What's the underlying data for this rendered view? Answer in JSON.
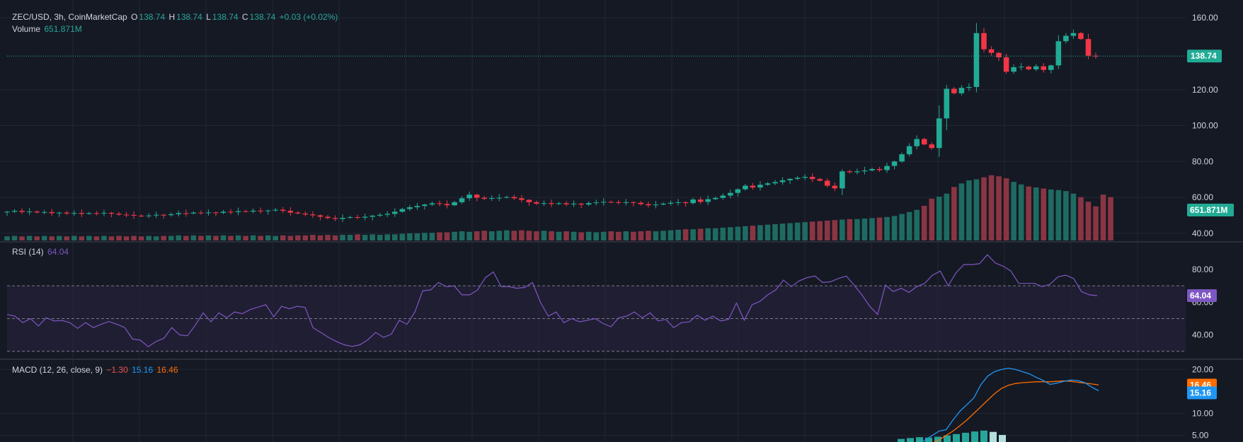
{
  "colors": {
    "background": "#151924",
    "grid": "#232734",
    "text": "#d1d4dc",
    "up": "#22ab94",
    "down": "#f23645",
    "volume_up": "#1e6b61",
    "volume_down": "#8a3543",
    "rsi": "#7e57c2",
    "rsi_band": "#2a2340",
    "macd": "#2196f3",
    "signal": "#ff6d00",
    "hist_up": "#26a69a",
    "hist_up_light": "#b2dfdb"
  },
  "legend": {
    "symbol": "ZEC/USD, 3h, CoinMarketCap",
    "o_label": "O",
    "o_value": "138.74",
    "h_label": "H",
    "h_value": "138.74",
    "l_label": "L",
    "l_value": "138.74",
    "c_label": "C",
    "c_value": "138.74",
    "change": "+0.03 (+0.02%)",
    "volume_label": "Volume",
    "volume_value": "651.871M",
    "rsi_label": "RSI (14)",
    "rsi_value": "64.04",
    "macd_label": "MACD (12, 26, close, 9)",
    "macd_hist_value": "−1.30",
    "macd_value": "15.16",
    "signal_value": "16.46"
  },
  "chart_data": [
    {
      "type": "candlestick",
      "pane": "price",
      "ylim": [
        36,
        166
      ],
      "y_ticks": [
        "160.00",
        "120.00",
        "100.00",
        "80.00",
        "60.00",
        "40.00"
      ],
      "y_tick_values": [
        160,
        120,
        100,
        80,
        60,
        40
      ],
      "last_price": 138.74,
      "last_price_label": "138.74",
      "volume_label": "651.871M",
      "closes": [
        52.0,
        52.5,
        51.9,
        52.1,
        51.6,
        51.8,
        51.2,
        51.5,
        51.0,
        51.3,
        50.8,
        51.2,
        51.0,
        51.4,
        50.9,
        50.4,
        50.2,
        49.8,
        49.5,
        49.9,
        50.3,
        50.1,
        50.6,
        51.2,
        51.0,
        51.5,
        51.3,
        51.6,
        51.4,
        52.0,
        51.8,
        52.3,
        52.1,
        52.6,
        52.4,
        52.7,
        53.1,
        52.5,
        51.5,
        51.0,
        50.5,
        50.0,
        49.2,
        48.5,
        48.0,
        48.6,
        49.0,
        48.7,
        49.2,
        49.8,
        50.3,
        50.8,
        52.0,
        53.5,
        54.5,
        55.2,
        56.0,
        56.7,
        56.3,
        55.6,
        57.3,
        59.5,
        61.5,
        59.8,
        59.2,
        59.6,
        59.8,
        60.2,
        59.5,
        58.6,
        57.3,
        56.5,
        56.8,
        56.3,
        56.7,
        56.1,
        56.5,
        56.0,
        56.8,
        57.2,
        57.5,
        57.3,
        57.0,
        57.3,
        57.0,
        56.2,
        55.6,
        56.0,
        56.5,
        57.0,
        57.3,
        56.8,
        58.8,
        57.5,
        59.0,
        59.7,
        61.0,
        62.5,
        64.5,
        66.5,
        65.5,
        67.0,
        67.8,
        68.5,
        69.5,
        70.3,
        70.9,
        71.4,
        70.2,
        69.3,
        66.5,
        65.0,
        74.5,
        74.0,
        74.5,
        75.0,
        75.8,
        75.2,
        77.5,
        80.0,
        84.0,
        88.5,
        92.5,
        89.5,
        87.5,
        104.0,
        120.5,
        118.0,
        121.0,
        121.5,
        151.5,
        142.5,
        140.5,
        138.0,
        130.0,
        132.5,
        132.8,
        131.3,
        133.0,
        131.0,
        133.5,
        147.0,
        150.0,
        151.5,
        148.2,
        138.9,
        138.74
      ],
      "volumes": [
        8,
        9,
        8,
        9,
        8,
        9,
        8,
        9,
        8,
        9,
        8,
        9,
        8,
        9,
        8,
        9,
        8,
        9,
        8,
        9,
        8,
        9,
        9,
        10,
        9,
        10,
        9,
        10,
        9,
        10,
        9,
        10,
        9,
        10,
        9,
        10,
        9,
        10,
        9,
        10,
        10,
        11,
        10,
        11,
        10,
        11,
        11,
        12,
        11,
        12,
        11,
        12,
        12,
        13,
        14,
        14,
        15,
        15,
        16,
        16,
        17,
        18,
        17,
        18,
        19,
        18,
        19,
        20,
        19,
        20,
        19,
        18,
        19,
        18,
        17,
        18,
        17,
        16,
        17,
        16,
        17,
        18,
        17,
        18,
        17,
        18,
        19,
        18,
        19,
        20,
        21,
        22,
        22,
        23,
        24,
        24,
        25,
        26,
        27,
        28,
        29,
        30,
        31,
        32,
        33,
        34,
        35,
        36,
        37,
        38,
        39,
        40,
        41,
        42,
        42,
        43,
        44,
        45,
        46,
        48,
        52,
        56,
        60,
        68,
        82,
        86,
        92,
        105,
        112,
        118,
        120,
        124,
        128,
        126,
        122,
        115,
        110,
        106,
        104,
        102,
        100,
        99,
        97,
        92,
        85,
        76,
        67,
        90,
        85
      ]
    },
    {
      "type": "line",
      "pane": "rsi",
      "ylim": [
        26,
        96
      ],
      "y_ticks": [
        "80.00",
        "60.00",
        "40.00"
      ],
      "y_tick_values": [
        80,
        60,
        40
      ],
      "levels": [
        70,
        50,
        30
      ],
      "band": [
        30,
        70
      ],
      "last_label": "64.04",
      "values": [
        52.5,
        51.5,
        47.5,
        50.0,
        45.5,
        50.5,
        48.5,
        48.8,
        47.5,
        44.0,
        47.5,
        44.5,
        46.5,
        48.2,
        46.5,
        44.5,
        37.5,
        36.8,
        32.8,
        36.0,
        38.0,
        44.5,
        40.0,
        39.5,
        46.0,
        53.5,
        48.0,
        53.5,
        50.5,
        54.0,
        53.0,
        55.5,
        57.0,
        58.5,
        51.0,
        57.5,
        56.0,
        57.5,
        56.8,
        44.5,
        41.5,
        38.5,
        36.0,
        34.0,
        33.0,
        34.0,
        37.0,
        41.5,
        38.5,
        40.5,
        49.0,
        46.5,
        54.0,
        67.0,
        67.5,
        72.0,
        69.5,
        70.0,
        64.5,
        64.5,
        67.5,
        75.0,
        78.5,
        69.5,
        69.5,
        68.5,
        69.0,
        72.0,
        60.0,
        51.5,
        54.0,
        47.5,
        50.0,
        48.0,
        49.0,
        50.0,
        47.0,
        45.0,
        50.5,
        51.5,
        54.0,
        50.5,
        53.5,
        48.5,
        49.5,
        44.5,
        47.5,
        48.0,
        52.0,
        49.0,
        51.5,
        48.5,
        49.5,
        59.5,
        49.0,
        58.5,
        60.5,
        64.5,
        67.5,
        73.5,
        69.5,
        73.0,
        75.0,
        76.0,
        72.0,
        72.5,
        74.5,
        76.0,
        70.5,
        64.5,
        57.5,
        52.5,
        70.5,
        66.5,
        68.5,
        66.0,
        69.5,
        71.5,
        76.5,
        79.0,
        70.0,
        78.0,
        83.0,
        83.0,
        83.5,
        89.0,
        84.0,
        82.0,
        79.0,
        71.5,
        71.5,
        71.5,
        69.5,
        71.0,
        75.5,
        76.5,
        74.5,
        66.5,
        64.5,
        64.04
      ]
    },
    {
      "type": "line",
      "pane": "macd",
      "ylim": [
        3.5,
        22.0
      ],
      "y_ticks": [
        "20.00",
        "10.00",
        "5.00"
      ],
      "y_tick_values": [
        20,
        10,
        5
      ],
      "macd_label": "15.16",
      "signal_label": "16.46",
      "macd_values": [
        1.0,
        1.5,
        2.0,
        2.8,
        4.0,
        5.0,
        6.0,
        6.3,
        8.5,
        10.5,
        12.0,
        13.5,
        16.5,
        18.5,
        19.5,
        20.0,
        20.3,
        20.0,
        19.5,
        19.0,
        18.2,
        17.5,
        16.6,
        16.9,
        17.3,
        17.6,
        17.5,
        17.0,
        16.0,
        15.16
      ],
      "signal_values": [
        0.5,
        0.8,
        1.2,
        1.8,
        2.5,
        3.2,
        4.0,
        5.0,
        6.0,
        7.2,
        8.5,
        10.0,
        11.5,
        13.0,
        14.5,
        15.7,
        16.4,
        16.8,
        17.0,
        17.1,
        17.2,
        17.2,
        17.2,
        17.3,
        17.4,
        17.3,
        17.1,
        16.9,
        16.7,
        16.46
      ],
      "histogram_values": [
        4.2,
        4.4,
        4.6,
        4.5,
        4.7,
        5.0,
        5.3,
        5.6,
        5.9,
        6.1,
        5.8,
        5.1
      ]
    }
  ]
}
